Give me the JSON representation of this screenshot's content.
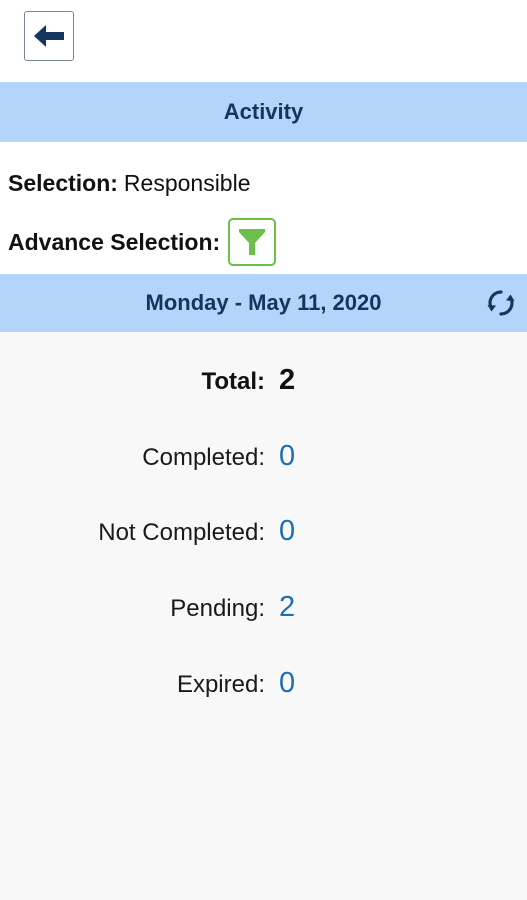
{
  "header": {
    "back_button_label": "Back",
    "section_title": "Activity"
  },
  "selection": {
    "label": "Selection:",
    "value": "Responsible",
    "advance_label": "Advance Selection:"
  },
  "date_bar": {
    "date_text": "Monday - May 11, 2020"
  },
  "stats": [
    {
      "label": "Total:",
      "value": "2"
    },
    {
      "label": "Completed:",
      "value": "0"
    },
    {
      "label": "Not Completed:",
      "value": "0"
    },
    {
      "label": "Pending:",
      "value": "2"
    },
    {
      "label": "Expired:",
      "value": "0"
    }
  ],
  "colors": {
    "band_background": "#b3d5fb",
    "band_text": "#14355e",
    "value_blue": "#1b6fb4",
    "filter_green": "#6cc04a",
    "back_arrow": "#14355e"
  },
  "icons": {
    "back": "arrow-left-icon",
    "filter": "funnel-icon",
    "refresh": "refresh-icon"
  }
}
